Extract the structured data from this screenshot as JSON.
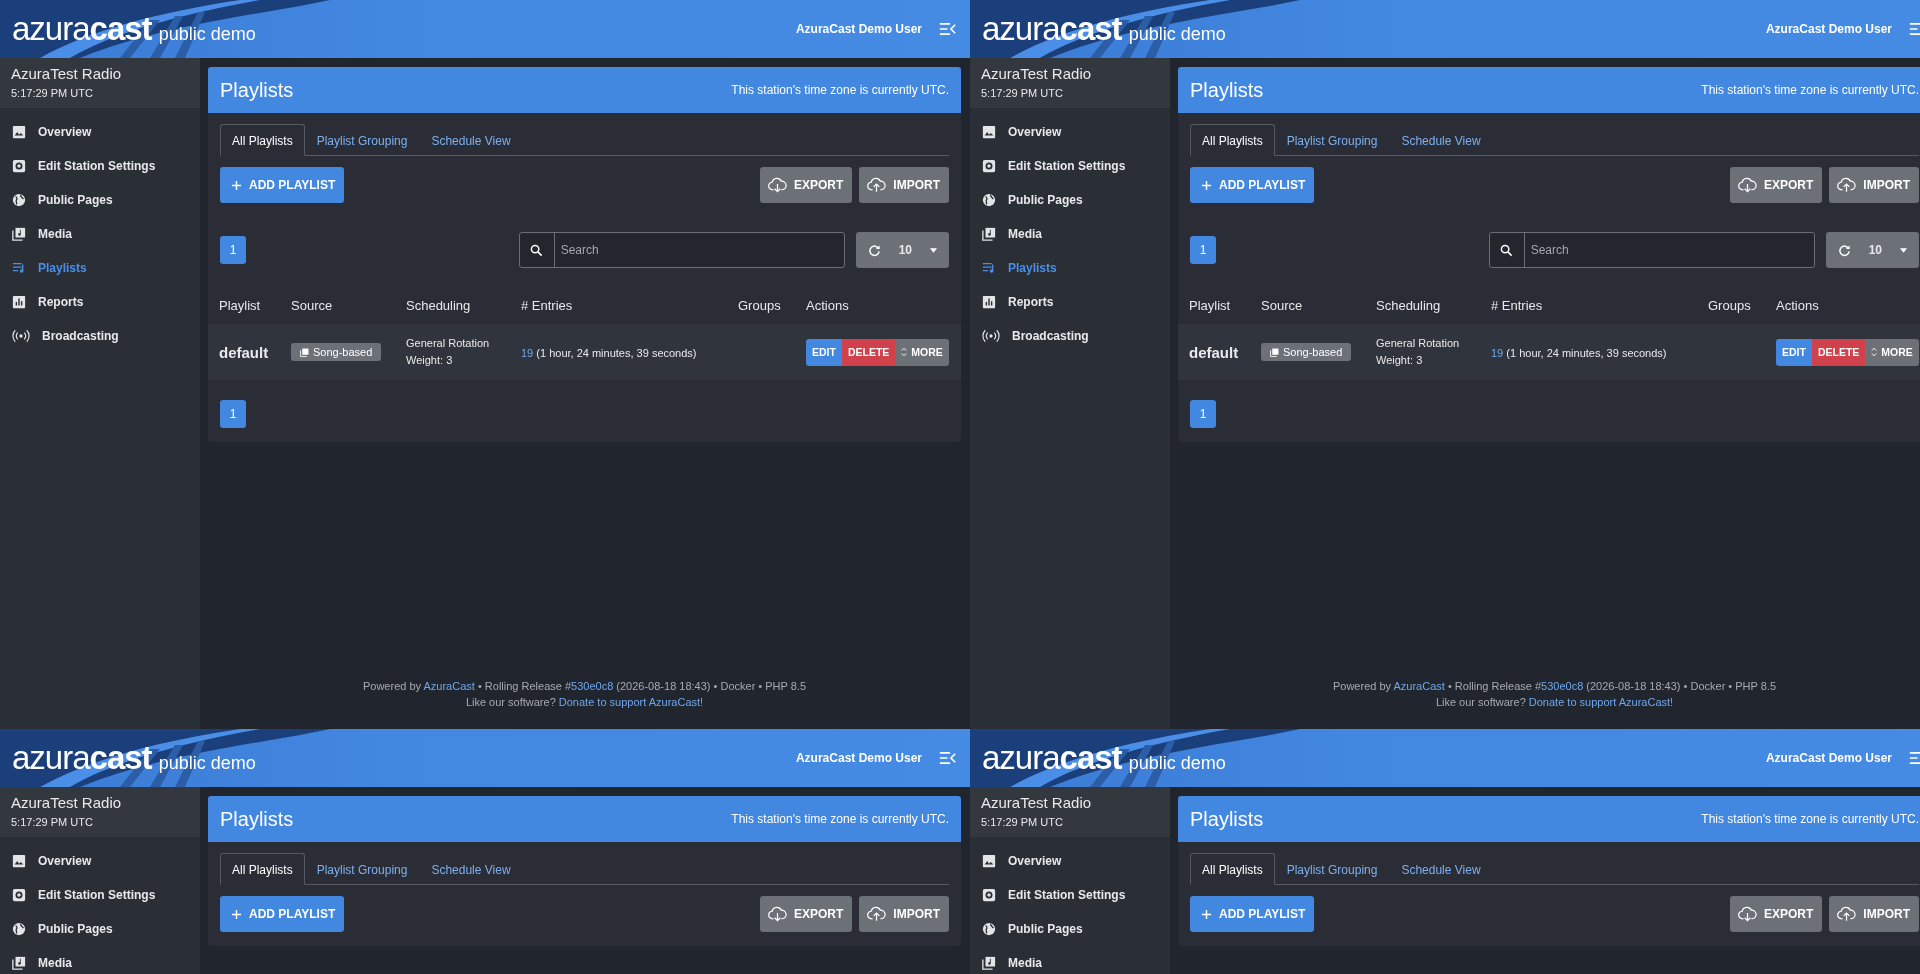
{
  "tiles": [
    {
      "header": {
        "logo": "azura**cast**",
        "subtitle": "public demo",
        "user": "AzuraCast Demo User"
      },
      "sidebar": {
        "station": "AzuraTest Radio",
        "time": "5:17:29 PM UTC",
        "items": [
          {
            "label": "Overview",
            "selected": false
          },
          {
            "label": "Edit Station Settings",
            "selected": false
          },
          {
            "label": "Public Pages",
            "selected": false
          },
          {
            "label": "Media",
            "selected": false
          },
          {
            "label": "Playlists",
            "selected": true
          },
          {
            "label": "Reports",
            "selected": false
          },
          {
            "label": "Broadcasting",
            "selected": false
          }
        ]
      },
      "panel": {
        "title": "Playlists",
        "note": "This station's time zone is currently UTC.",
        "tabs": [
          {
            "label": "All Playlists",
            "selected": true
          },
          {
            "label": "Playlist Grouping",
            "selected": false
          },
          {
            "label": "Schedule View",
            "selected": false
          }
        ],
        "add_button": "ADD PLAYLIST",
        "export_button": "EXPORT",
        "import_button": "IMPORT",
        "pager_top": [
          {
            "label": "1",
            "selected": true
          }
        ],
        "search": {
          "placeholder": "Search"
        },
        "per_page": "10",
        "columns": [
          "Playlist",
          "Source",
          "Scheduling",
          "# Entries",
          "Groups",
          "Actions"
        ],
        "rows": [
          {
            "name": "default",
            "source": "Song-based",
            "scheduling": [
              "General Rotation",
              "Weight: 3"
            ],
            "entries_count": "19",
            "entries_duration": " (1 hour, 24 minutes, 39 seconds)",
            "actions": [
              "EDIT",
              "DELETE",
              "MORE"
            ]
          }
        ],
        "pager_bottom": [
          {
            "label": "1",
            "selected": true
          }
        ]
      },
      "footer": {
        "powered": "Powered by ",
        "brand": "AzuraCast",
        "release": " • Rolling Release #",
        "commit": "530e0c8",
        "details": " (2026-08-18 18:43) • Docker • PHP 8.5",
        "donate_prefix": "Like our software? ",
        "donate_link": "Donate to support AzuraCast!"
      }
    },
    {
      "header": {
        "logo": "azura**cast**",
        "subtitle": "public demo",
        "user": "AzuraCast Demo User"
      },
      "sidebar": {
        "station": "AzuraTest Radio",
        "time": "5:17:29 PM UTC",
        "items": [
          {
            "label": "Overview",
            "selected": false
          },
          {
            "label": "Edit Station Settings",
            "selected": false
          },
          {
            "label": "Public Pages",
            "selected": false
          },
          {
            "label": "Media",
            "selected": false
          },
          {
            "label": "Playlists",
            "selected": true
          },
          {
            "label": "Reports",
            "selected": false
          },
          {
            "label": "Broadcasting",
            "selected": false
          }
        ]
      },
      "panel": {
        "title": "Playlists",
        "note": "This station's time zone is currently UTC.",
        "tabs": [
          {
            "label": "All Playlists",
            "selected": true
          },
          {
            "label": "Playlist Grouping",
            "selected": false
          },
          {
            "label": "Schedule View",
            "selected": false
          }
        ],
        "add_button": "ADD PLAYLIST",
        "export_button": "EXPORT",
        "import_button": "IMPORT",
        "pager_top": [
          {
            "label": "1",
            "selected": true
          }
        ],
        "search": {
          "placeholder": "Search"
        },
        "per_page": "10",
        "columns": [
          "Playlist",
          "Source",
          "Scheduling",
          "# Entries",
          "Groups",
          "Actions"
        ],
        "rows": [
          {
            "name": "default",
            "source": "Song-based",
            "scheduling": [
              "General Rotation",
              "Weight: 3"
            ],
            "entries_count": "19",
            "entries_duration": " (1 hour, 24 minutes, 39 seconds)",
            "actions": [
              "EDIT",
              "DELETE",
              "MORE"
            ]
          }
        ],
        "pager_bottom": [
          {
            "label": "1",
            "selected": true
          }
        ]
      },
      "footer": {
        "powered": "Powered by ",
        "brand": "AzuraCast",
        "release": " • Rolling Release #",
        "commit": "530e0c8",
        "details": " (2026-08-18 18:43) • Docker • PHP 8.5",
        "donate_prefix": "Like our software? ",
        "donate_link": "Donate to support AzuraCast!"
      }
    },
    {
      "header": {
        "logo": "azura**cast**",
        "subtitle": "public demo",
        "user": "AzuraCast Demo User"
      },
      "sidebar": {
        "station": "AzuraTest Radio",
        "time": "5:17:29 PM UTC",
        "items": [
          {
            "label": "Overview",
            "selected": false
          },
          {
            "label": "Edit Station Settings",
            "selected": false
          },
          {
            "label": "Public Pages",
            "selected": false
          },
          {
            "label": "Media",
            "selected": false
          }
        ]
      },
      "panel": {
        "title": "Playlists",
        "note": "This station's time zone is currently UTC.",
        "tabs": [
          {
            "label": "All Playlists",
            "selected": true
          },
          {
            "label": "Playlist Grouping",
            "selected": false
          },
          {
            "label": "Schedule View",
            "selected": false
          }
        ],
        "add_button": "ADD PLAYLIST",
        "export_button": "EXPORT",
        "import_button": "IMPORT"
      }
    },
    {
      "header": {
        "logo": "azura**cast**",
        "subtitle": "public demo",
        "user": "AzuraCast Demo User"
      },
      "sidebar": {
        "station": "AzuraTest Radio",
        "time": "5:17:29 PM UTC",
        "items": [
          {
            "label": "Overview",
            "selected": false
          },
          {
            "label": "Edit Station Settings",
            "selected": false
          },
          {
            "label": "Public Pages",
            "selected": false
          },
          {
            "label": "Media",
            "selected": false
          }
        ]
      },
      "panel": {
        "title": "Playlists",
        "note": "This station's time zone is currently UTC.",
        "tabs": [
          {
            "label": "All Playlists",
            "selected": true
          },
          {
            "label": "Playlist Grouping",
            "selected": false
          },
          {
            "label": "Schedule View",
            "selected": false
          }
        ],
        "add_button": "ADD PLAYLIST",
        "export_button": "EXPORT",
        "import_button": "IMPORT"
      }
    }
  ]
}
